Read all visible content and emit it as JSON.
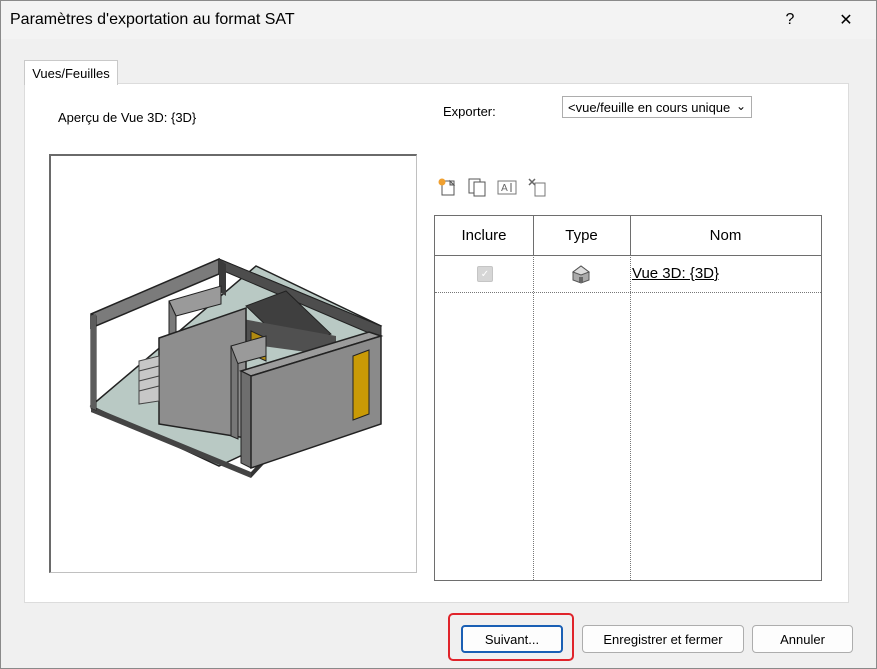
{
  "window": {
    "title": "Paramètres d'exportation au format SAT",
    "help_label": "?",
    "close_label": "✕"
  },
  "tabs": [
    {
      "label": "Vues/Feuilles"
    }
  ],
  "preview": {
    "label": "Aperçu de Vue 3D: {3D}"
  },
  "export": {
    "label": "Exporter:",
    "selected": "<vue/feuille en cours unique"
  },
  "toolbar": {
    "icons": [
      "new-set-icon",
      "duplicate-set-icon",
      "rename-set-icon",
      "delete-set-icon"
    ]
  },
  "table": {
    "columns": [
      "Inclure",
      "Type",
      "Nom"
    ],
    "rows": [
      {
        "include": true,
        "type_icon": "3d-view-icon",
        "name": "Vue 3D: {3D}"
      }
    ]
  },
  "buttons": {
    "next": "Suivant...",
    "save_close": "Enregistrer et fermer",
    "cancel": "Annuler"
  },
  "colors": {
    "highlight": "#e0242b",
    "door": "#c99a06"
  }
}
